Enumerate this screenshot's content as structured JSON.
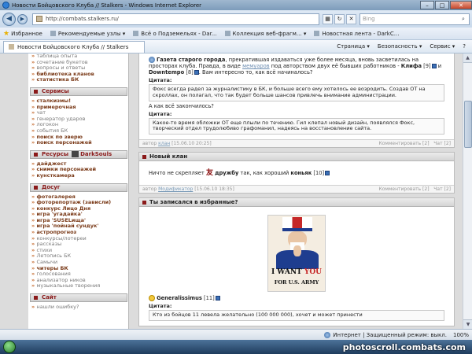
{
  "window": {
    "title": "Новости Бойцовского Клуба // Stalkers - Windows Internet Explorer",
    "minimize": "–",
    "maximize": "□",
    "close": "✕"
  },
  "address": {
    "url": "http://combats.stalkers.ru/",
    "search_placeholder": "Bing"
  },
  "favorites": {
    "label": "Избранное",
    "items": [
      "Рекомендуемые узлы ▾",
      "Всё о Подземельях - Dar...",
      "Коллекция веб-фрагм... ▾",
      "Новостная лента - DarkC..."
    ]
  },
  "tab": {
    "label": "Новости Бойцовского Клуба // Stalkers"
  },
  "commands": [
    "Страница ▾",
    "Безопасность ▾",
    "Сервис ▾",
    "?"
  ],
  "sidebar": {
    "top_links": [
      "таблица опыта",
      "сочетание букетов",
      "вопросы и ответы",
      "библиотека кланов",
      "статистика БК"
    ],
    "sections": [
      {
        "title": "Сервисы",
        "links": [
          {
            "text": "сталкизмы!",
            "bold": true
          },
          {
            "text": "примерочная",
            "bold": true
          },
          {
            "text": "чат",
            "bold": false
          },
          {
            "text": "генератор ударов",
            "bold": false
          },
          {
            "text": "логокон",
            "bold": false
          },
          {
            "text": "события БК",
            "bold": false
          },
          {
            "text": "поиск по зверю",
            "bold": true
          },
          {
            "text": "поиск персонажей",
            "bold": true
          }
        ]
      },
      {
        "title": "Ресурсы",
        "title_extra": "DarkSouls",
        "links": [
          {
            "text": "дайджест",
            "bold": true
          },
          {
            "text": "снимки персонажей",
            "bold": true
          },
          {
            "text": "кунсткамера",
            "bold": true
          }
        ]
      },
      {
        "title": "Досуг",
        "links": [
          {
            "text": "фотогалерея",
            "bold": true
          },
          {
            "text": "фоторепортаж (зависли)",
            "bold": true
          },
          {
            "text": "конкурс Лицо Дня",
            "bold": true
          },
          {
            "text": "игра 'угадайка'",
            "bold": true
          },
          {
            "text": "игра 'SUSELища'",
            "bold": true
          },
          {
            "text": "игра 'пойнай сундук'",
            "bold": true
          },
          {
            "text": "астропрогноз",
            "bold": true
          },
          {
            "text": "конкурсы/лотереи",
            "bold": false
          },
          {
            "text": "рассказы",
            "bold": false
          },
          {
            "text": "стихи",
            "bold": false
          },
          {
            "text": "Летопись БК",
            "bold": false
          },
          {
            "text": "Самычи",
            "bold": false
          },
          {
            "text": "читеры БК",
            "bold": true
          },
          {
            "text": "голосования",
            "bold": false
          },
          {
            "text": "анализатор ников",
            "bold": false
          },
          {
            "text": "музыкальные творения",
            "bold": false
          }
        ]
      },
      {
        "title": "Сайт",
        "links": [
          {
            "text": "нашли ошибку?",
            "bold": false
          }
        ]
      }
    ]
  },
  "posts": [
    {
      "intro_bold": "Газета старого города",
      "intro_rest": ", прекратившая издаваться уже более месяца, вновь засветилась на просторах клуба. Правда, в виде",
      "intro_link": "мемуаров",
      "intro_rest2": " под авторством двух её бывших работников -",
      "nick1": "Клифа",
      "nick1_level": "[9]",
      "and": "и",
      "nick2": "Downtempo",
      "nick2_level": "[8]",
      "question": ". Вам интересно то, как всё начиналось?",
      "quote_label": "Цитата:",
      "quote1": "Фокс всегда радел за журналистику в БК, и больше всего ему хотелось ее возродить. Создав ОТ на скроллах, он полагал, что так будет больше шансов привлечь внимание администрации.",
      "question2": "А как всё закончилось?",
      "quote_label2": "Цитата:",
      "quote2": "Какое-то время обложки ОТ еще плыли по течению. Гил клепал новый дизайн, появлялся Фокс, творческий отдел трудолюбиво графоманил, надеясь на восстановление сайта.",
      "foot_prefix": "автор",
      "foot_author": "клан",
      "foot_date": "[15.06.10 20:25]",
      "foot_comments": "Комментировать [2]",
      "foot_chat": "Чат [2]"
    },
    {
      "title": "Новый клан",
      "text_before": "Ничто не скрепляет",
      "kanji": "友",
      "bold_word": "дружбу",
      "text_mid": "так, как хороший",
      "nick": "коньяк",
      "nick_level": "[10]",
      "foot_prefix": "автор",
      "foot_author": "Модификатор",
      "foot_date": "[15.06.10 18:35]",
      "foot_comments": "Комментировать [2]",
      "foot_chat": "Чат [2]"
    },
    {
      "title": "Ты записался в избранные?",
      "poster_line1_a": "I WANT ",
      "poster_line1_b": "YOU",
      "poster_line2": "FOR U.S. ARMY",
      "nick": "Generalissimus",
      "nick_level": "[11]",
      "quote_label": "Цитата:",
      "quote": "Кто из бойцов 11 левела желательно (100 000 000), хочет и может принести"
    }
  ],
  "status": {
    "zone": "Интернет | Защищенный режим: выкл.",
    "zoom": "100%"
  },
  "watermark": "photoscroll.combats.com"
}
